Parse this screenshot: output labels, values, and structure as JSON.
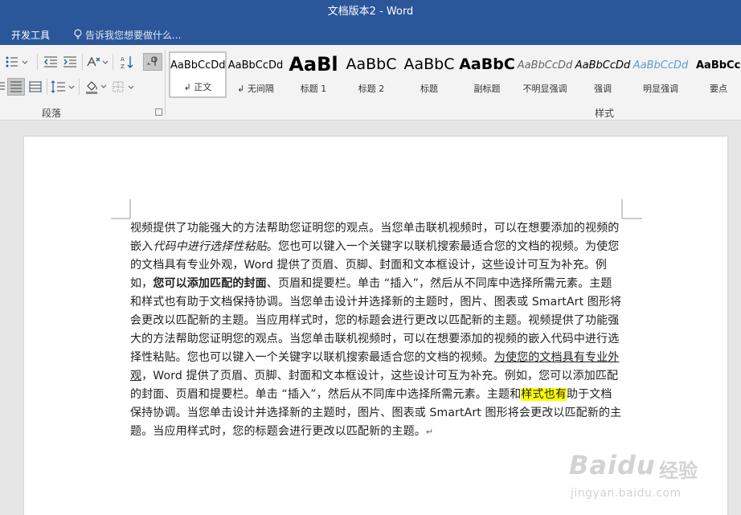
{
  "window": {
    "title": "文档版本2 - Word"
  },
  "menubar": {
    "tab_developer": "开发工具",
    "tell_me_placeholder": "告诉我您想要做什么..."
  },
  "ribbon": {
    "paragraph_group_label": "段落",
    "styles_group_label": "样式",
    "styles": [
      {
        "preview": "AaBbCcDd",
        "name": "↲ 正文",
        "active": true
      },
      {
        "preview": "AaBbCcDd",
        "name": "↲ 无间隔"
      },
      {
        "preview": "AaBl",
        "name": "标题 1"
      },
      {
        "preview": "AaBbC",
        "name": "标题 2"
      },
      {
        "preview": "AaBbC",
        "name": "标题"
      },
      {
        "preview": "AaBbC",
        "name": "副标题"
      },
      {
        "preview": "AaBbCcDd",
        "name": "不明显强调"
      },
      {
        "preview": "AaBbCcDd",
        "name": "强调"
      },
      {
        "preview": "AaBbCcDd",
        "name": "明显强调"
      },
      {
        "preview": "AaBbCcD",
        "name": "要点"
      }
    ]
  },
  "document": {
    "segments": [
      {
        "text": "视频提供了功能强大的方法帮助您证明您的观点。当您单击联机视频时，可以在想要添加的视频的嵌入",
        "style": ""
      },
      {
        "text": "代码中进行选择性粘贴",
        "style": "i"
      },
      {
        "text": "。您也可以键入一个关键字以联机搜索最适合您的文档的视频。为使您的文档具有专业外观，Word 提供了页眉、页脚、封面和文本框设计，这些设计可互为补充。例如，",
        "style": ""
      },
      {
        "text": "您可以添加匹配的封面",
        "style": "b"
      },
      {
        "text": "、页眉和提要栏。单击 “插入”，然后从不同库中选择所需元素。主题和样式也有助于文档保持协调。当您单击设计并选择新的主题时，图片、图表或 SmartArt 图形将会更改以匹配新的主题。当应用样式时，您的标题会进行更改以匹配新的主题。视频提供了功能强大的方法帮助您证明您的观点。当您单击联机视频时，可以在想要添加的视频的嵌入代码中进行选择性粘贴。您也可以键入一个关键字以联机搜索最适合您的文档的视频。",
        "style": ""
      },
      {
        "text": "为使您的文档具有专业外观",
        "style": "u"
      },
      {
        "text": "，Word 提供了页眉、页脚、封面和文本框设计，这些设计可互为补充。例如，您可以添加匹配的封面、页眉和提要栏。单击 “插入”，然后从不同库中选择所需元素。主题和",
        "style": ""
      },
      {
        "text": "样式也有",
        "style": "hl"
      },
      {
        "text": "助于文档保持协调。当您单击设计并选择新的主题时，图片、图表或 SmartArt 图形将会更改以匹配新的主题。当应用样式时，您的标题会进行更改以匹配新的主题。",
        "style": ""
      },
      {
        "text": "↵",
        "style": "pm"
      }
    ]
  },
  "watermark": {
    "brand": "Baidu",
    "brand_cn": "经验",
    "url": "jingyan.baidu.com"
  },
  "colors": {
    "titlebar": "#2b579a",
    "highlight": "#ffff00",
    "ribbon_bg": "#f3f3f3"
  }
}
